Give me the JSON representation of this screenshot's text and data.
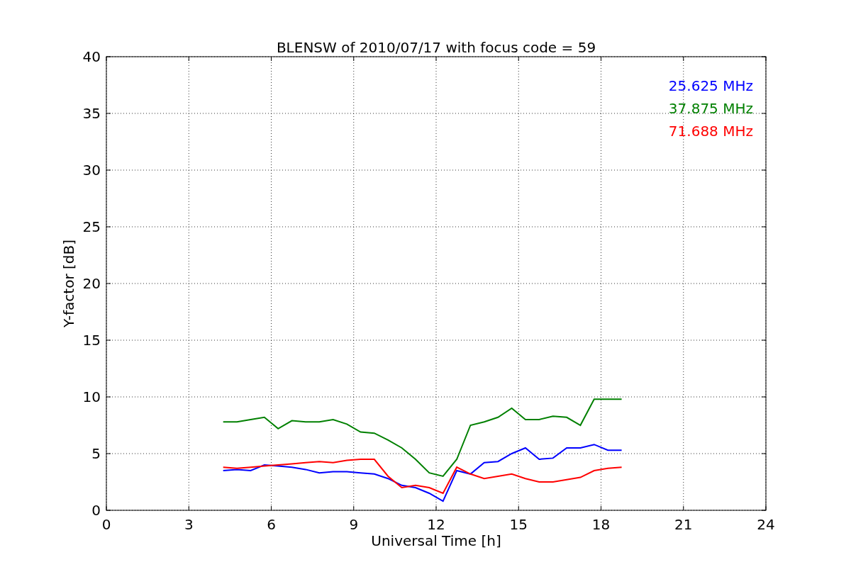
{
  "chart": {
    "chart_data": {
      "type": "line",
      "title": "BLENSW of 2010/07/17 with focus code = 59",
      "xlabel": "Universal Time [h]",
      "ylabel": "Y-factor [dB]",
      "x": [
        4.25,
        4.75,
        5.25,
        5.75,
        6.25,
        6.75,
        7.25,
        7.75,
        8.25,
        8.75,
        9.25,
        9.75,
        10.25,
        10.75,
        11.25,
        11.75,
        12.25,
        12.75,
        13.25,
        13.75,
        14.25,
        14.75,
        15.25,
        15.75,
        16.25,
        16.75,
        17.25,
        17.75,
        18.25,
        18.75
      ],
      "grid": true,
      "xlim": [
        0,
        24
      ],
      "ylim": [
        0,
        40
      ],
      "xticks": [
        0,
        3,
        6,
        9,
        12,
        15,
        18,
        21,
        24
      ],
      "yticks": [
        0,
        5,
        10,
        15,
        20,
        25,
        30,
        35,
        40
      ],
      "series": [
        {
          "name": "25.625 MHz",
          "color": "#0000ff",
          "values": [
            3.5,
            3.6,
            3.5,
            4.0,
            3.9,
            3.8,
            3.6,
            3.3,
            3.4,
            3.4,
            3.3,
            3.2,
            2.8,
            2.2,
            2.0,
            1.5,
            0.8,
            3.5,
            3.2,
            4.2,
            4.3,
            5.0,
            5.5,
            4.5,
            4.6,
            5.5,
            5.5,
            5.8,
            5.3,
            5.3
          ]
        },
        {
          "name": "37.875 MHz",
          "color": "#008000",
          "values": [
            7.8,
            7.8,
            8.0,
            8.2,
            7.2,
            7.9,
            7.8,
            7.8,
            8.0,
            7.6,
            6.9,
            6.8,
            6.2,
            5.5,
            4.5,
            3.3,
            3.0,
            4.5,
            7.5,
            7.8,
            8.2,
            9.0,
            8.0,
            8.0,
            8.3,
            8.2,
            7.5,
            9.8,
            9.8,
            9.8
          ]
        },
        {
          "name": "71.688 MHz",
          "color": "#ff0000",
          "values": [
            3.8,
            3.7,
            3.8,
            3.9,
            4.0,
            4.1,
            4.2,
            4.3,
            4.2,
            4.4,
            4.5,
            4.5,
            3.0,
            2.0,
            2.2,
            2.0,
            1.5,
            3.8,
            3.2,
            2.8,
            3.0,
            3.2,
            2.8,
            2.5,
            2.5,
            2.7,
            2.9,
            3.5,
            3.7,
            3.8
          ]
        }
      ]
    }
  }
}
